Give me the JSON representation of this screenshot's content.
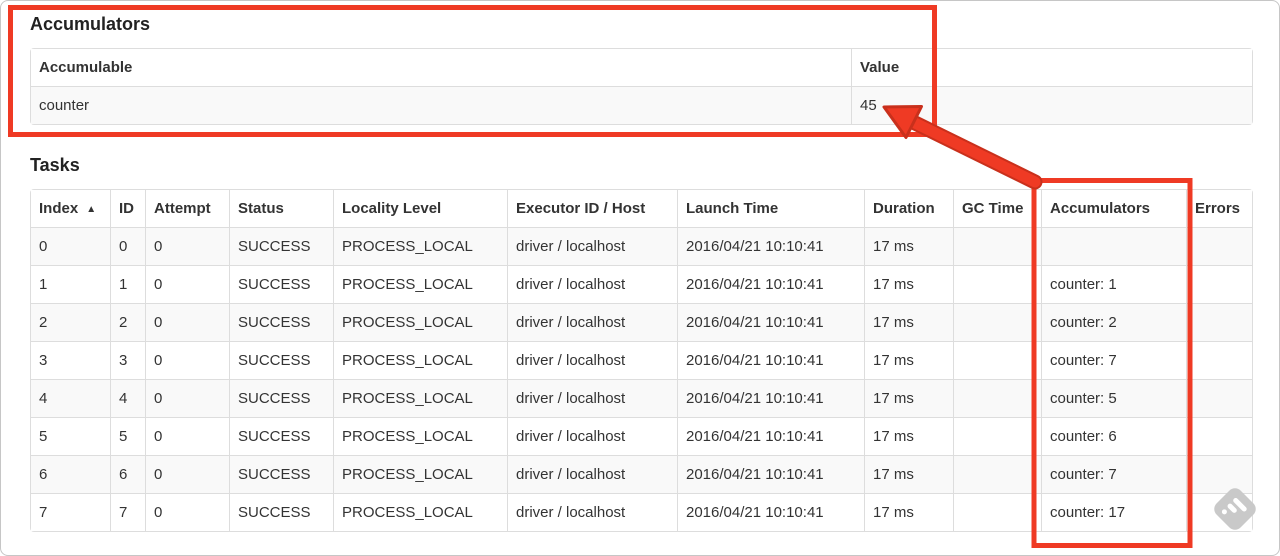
{
  "accumulators_section": {
    "title": "Accumulators",
    "headers": {
      "accumulable": "Accumulable",
      "value": "Value"
    },
    "rows": [
      {
        "accumulable": "counter",
        "value": "45"
      }
    ]
  },
  "tasks_section": {
    "title": "Tasks",
    "headers": {
      "index": "Index",
      "sort_indicator": "▲",
      "id": "ID",
      "attempt": "Attempt",
      "status": "Status",
      "locality": "Locality Level",
      "executor": "Executor ID / Host",
      "launch": "Launch Time",
      "duration": "Duration",
      "gc": "GC Time",
      "accumulators": "Accumulators",
      "errors": "Errors"
    },
    "rows": [
      {
        "index": "0",
        "id": "0",
        "attempt": "0",
        "status": "SUCCESS",
        "locality": "PROCESS_LOCAL",
        "executor": "driver / localhost",
        "launch": "2016/04/21 10:10:41",
        "duration": "17 ms",
        "gc": "",
        "accumulators": "",
        "errors": ""
      },
      {
        "index": "1",
        "id": "1",
        "attempt": "0",
        "status": "SUCCESS",
        "locality": "PROCESS_LOCAL",
        "executor": "driver / localhost",
        "launch": "2016/04/21 10:10:41",
        "duration": "17 ms",
        "gc": "",
        "accumulators": "counter: 1",
        "errors": ""
      },
      {
        "index": "2",
        "id": "2",
        "attempt": "0",
        "status": "SUCCESS",
        "locality": "PROCESS_LOCAL",
        "executor": "driver / localhost",
        "launch": "2016/04/21 10:10:41",
        "duration": "17 ms",
        "gc": "",
        "accumulators": "counter: 2",
        "errors": ""
      },
      {
        "index": "3",
        "id": "3",
        "attempt": "0",
        "status": "SUCCESS",
        "locality": "PROCESS_LOCAL",
        "executor": "driver / localhost",
        "launch": "2016/04/21 10:10:41",
        "duration": "17 ms",
        "gc": "",
        "accumulators": "counter: 7",
        "errors": ""
      },
      {
        "index": "4",
        "id": "4",
        "attempt": "0",
        "status": "SUCCESS",
        "locality": "PROCESS_LOCAL",
        "executor": "driver / localhost",
        "launch": "2016/04/21 10:10:41",
        "duration": "17 ms",
        "gc": "",
        "accumulators": "counter: 5",
        "errors": ""
      },
      {
        "index": "5",
        "id": "5",
        "attempt": "0",
        "status": "SUCCESS",
        "locality": "PROCESS_LOCAL",
        "executor": "driver / localhost",
        "launch": "2016/04/21 10:10:41",
        "duration": "17 ms",
        "gc": "",
        "accumulators": "counter: 6",
        "errors": ""
      },
      {
        "index": "6",
        "id": "6",
        "attempt": "0",
        "status": "SUCCESS",
        "locality": "PROCESS_LOCAL",
        "executor": "driver / localhost",
        "launch": "2016/04/21 10:10:41",
        "duration": "17 ms",
        "gc": "",
        "accumulators": "counter: 7",
        "errors": ""
      },
      {
        "index": "7",
        "id": "7",
        "attempt": "0",
        "status": "SUCCESS",
        "locality": "PROCESS_LOCAL",
        "executor": "driver / localhost",
        "launch": "2016/04/21 10:10:41",
        "duration": "17 ms",
        "gc": "",
        "accumulators": "counter: 17",
        "errors": ""
      }
    ]
  },
  "annotations": {
    "color": "#ef3a24",
    "edge_color": "#c9301c"
  },
  "watermark": {
    "color": "#c9c9c9",
    "mark_color": "#ffffff"
  }
}
